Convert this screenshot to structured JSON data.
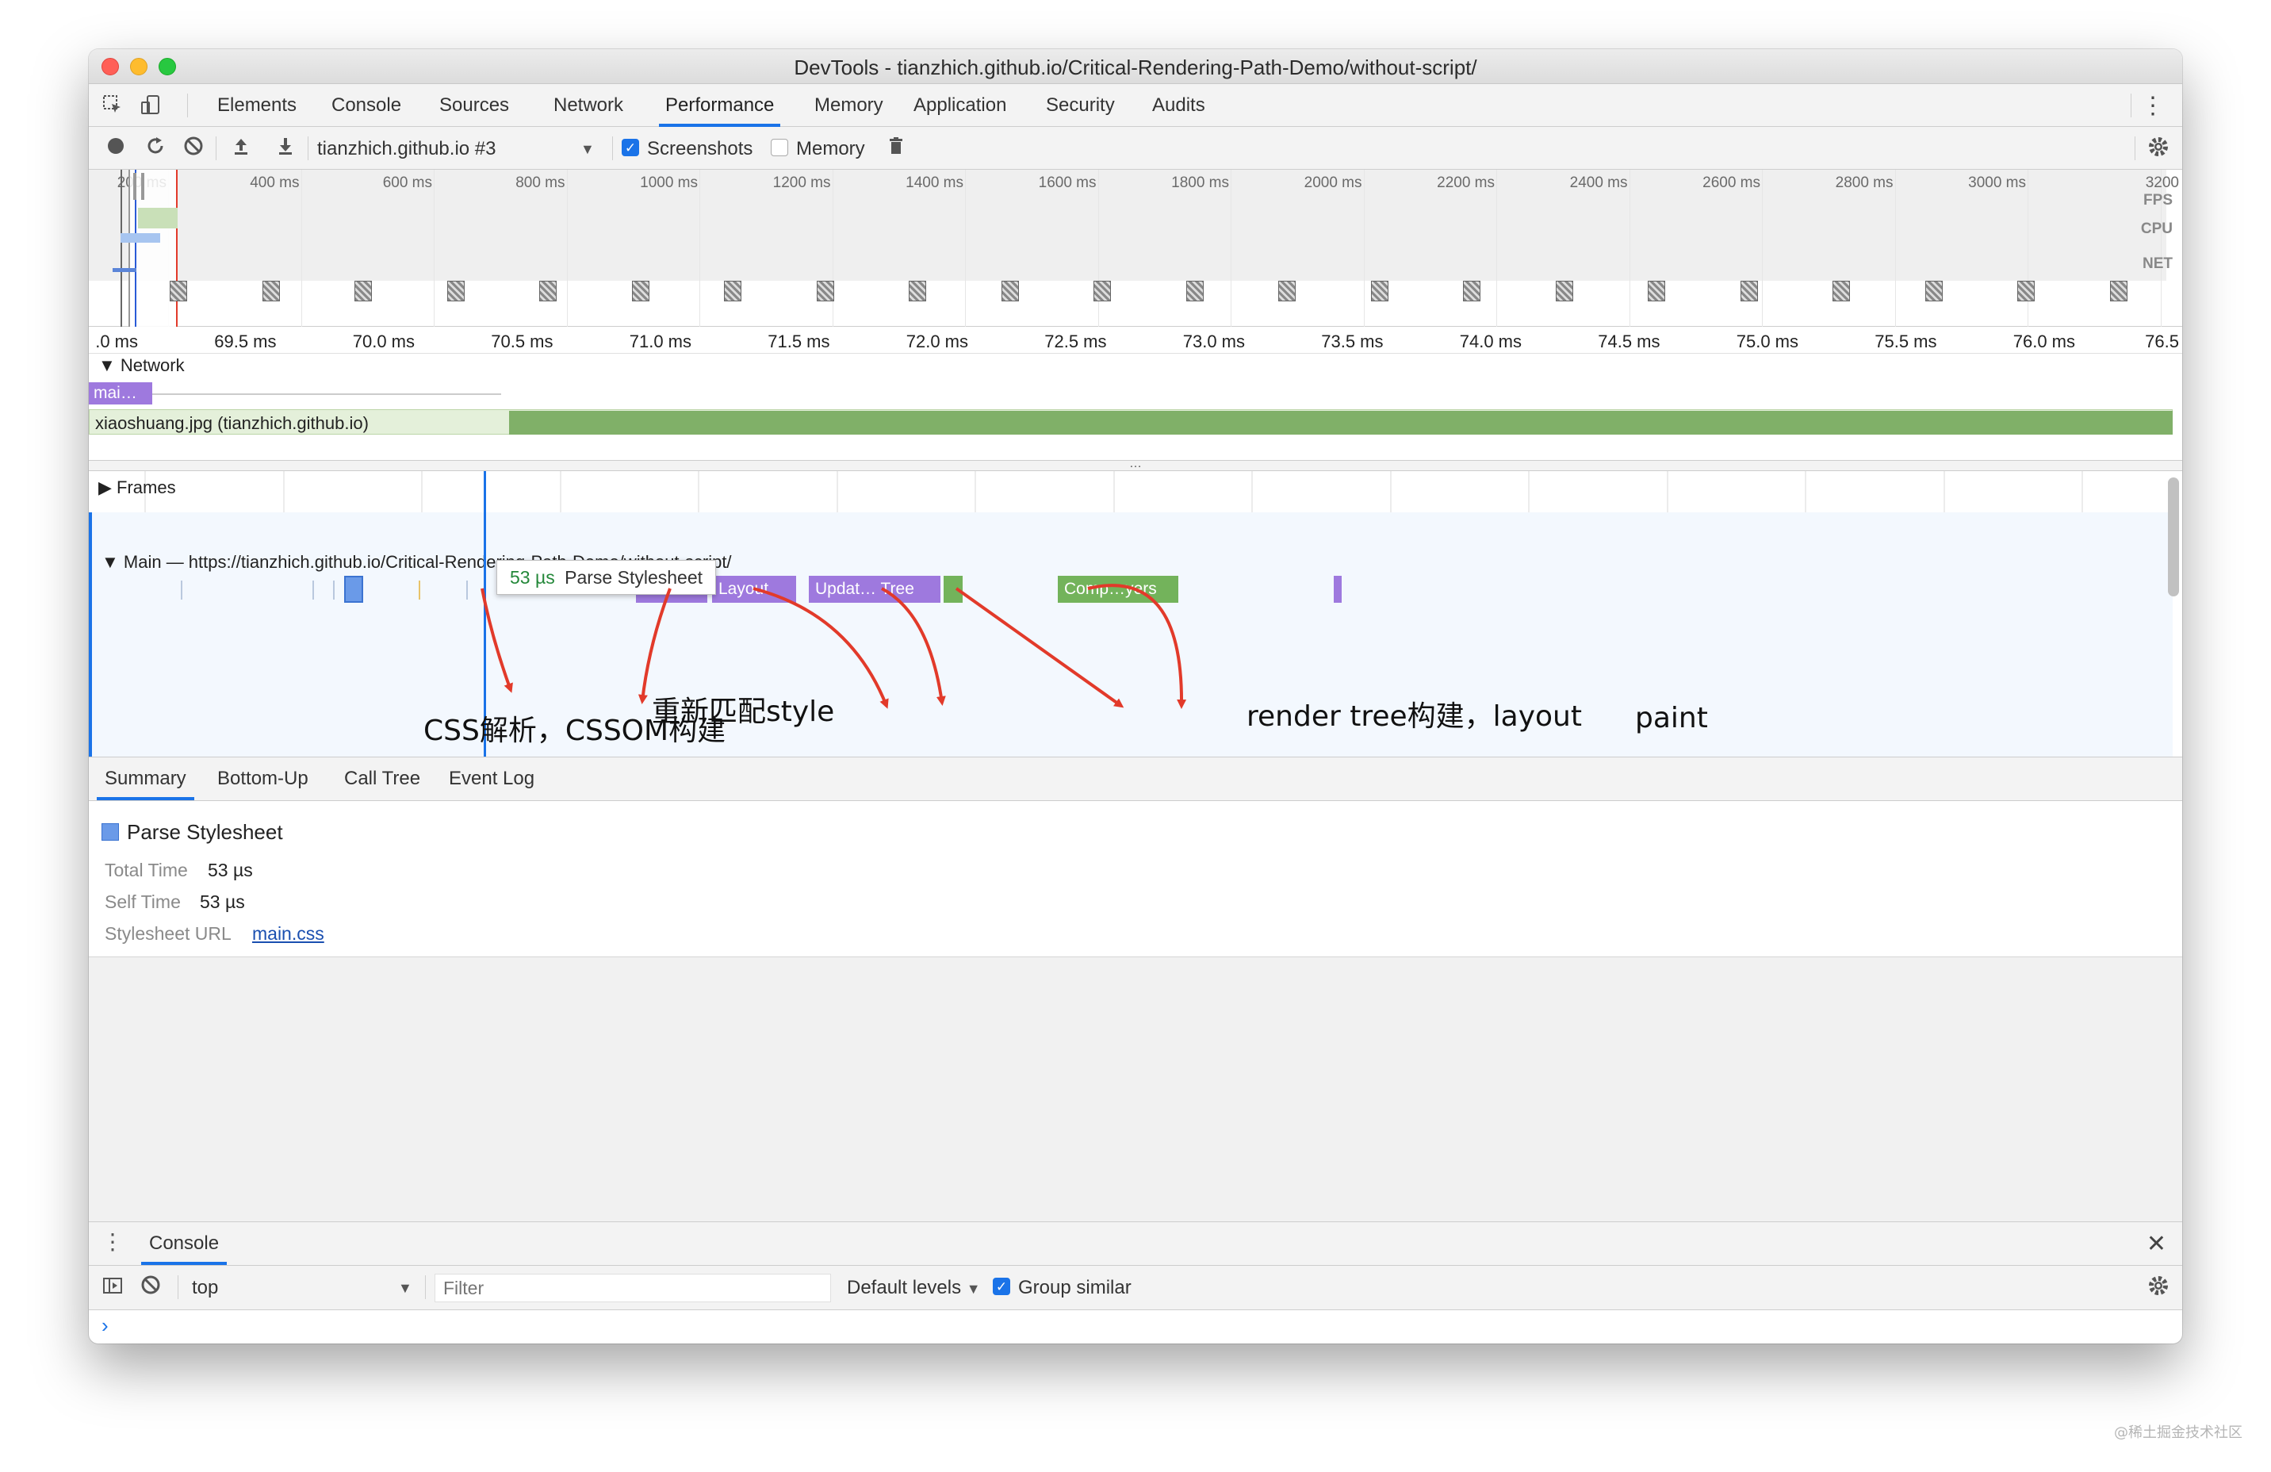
{
  "window": {
    "title": "DevTools - tianzhich.github.io/Critical-Rendering-Path-Demo/without-script/"
  },
  "tabs": [
    "Elements",
    "Console",
    "Sources",
    "Network",
    "Performance",
    "Memory",
    "Application",
    "Security",
    "Audits"
  ],
  "active_tab": "Performance",
  "toolbar": {
    "profile_select": "tianzhich.github.io #3",
    "screenshots_label": "Screenshots",
    "screenshots_checked": true,
    "memory_label": "Memory",
    "memory_checked": false
  },
  "overview": {
    "ticks": [
      "200 ms",
      "400 ms",
      "600 ms",
      "800 ms",
      "1000 ms",
      "1200 ms",
      "1400 ms",
      "1600 ms",
      "1800 ms",
      "2000 ms",
      "2200 ms",
      "2400 ms",
      "2600 ms",
      "2800 ms",
      "3000 ms",
      "3200"
    ],
    "labels": {
      "fps": "FPS",
      "cpu": "CPU",
      "net": "NET"
    }
  },
  "ruler": {
    "ticks": [
      ".0 ms",
      "69.5 ms",
      "70.0 ms",
      "70.5 ms",
      "71.0 ms",
      "71.5 ms",
      "72.0 ms",
      "72.5 ms",
      "73.0 ms",
      "73.5 ms",
      "74.0 ms",
      "74.5 ms",
      "75.0 ms",
      "75.5 ms",
      "76.0 ms",
      "76.5"
    ]
  },
  "network": {
    "header": "Network",
    "main_label": "mai…",
    "jpg_label": "xiaoshuang.jpg (tianzhich.github.io)"
  },
  "flame": {
    "frames_header": "Frames",
    "main_header": "Main — https://tianzhich.github.io/Critical-Rendering-Path-Demo/without-script/",
    "events": {
      "recalc": "Re…le",
      "layout": "Layout",
      "update": "Updat… Tree",
      "composite": "Comp…yers"
    },
    "tooltip": {
      "time": "53 µs",
      "name": "Parse Stylesheet"
    },
    "annotations": {
      "css": "CSS解析，CSSOM构建",
      "style": "重新匹配style",
      "render": "render tree构建，layout",
      "paint": "paint"
    },
    "colors": {
      "arrow": "#e23a2a",
      "purple": "#9e79de",
      "green": "#73b35b",
      "blue": "#6a9ae8"
    }
  },
  "summary": {
    "tabs": [
      "Summary",
      "Bottom-Up",
      "Call Tree",
      "Event Log"
    ],
    "title": "Parse Stylesheet",
    "total_time_key": "Total Time",
    "total_time": "53 µs",
    "self_time_key": "Self Time",
    "self_time": "53 µs",
    "stylesheet_key": "Stylesheet URL",
    "stylesheet_url": "main.css"
  },
  "console": {
    "tab": "Console",
    "context": "top",
    "filter_placeholder": "Filter",
    "levels": "Default levels",
    "group_similar": "Group similar",
    "group_similar_checked": true,
    "prompt": "›"
  },
  "watermark": "@稀土掘金技术社区"
}
